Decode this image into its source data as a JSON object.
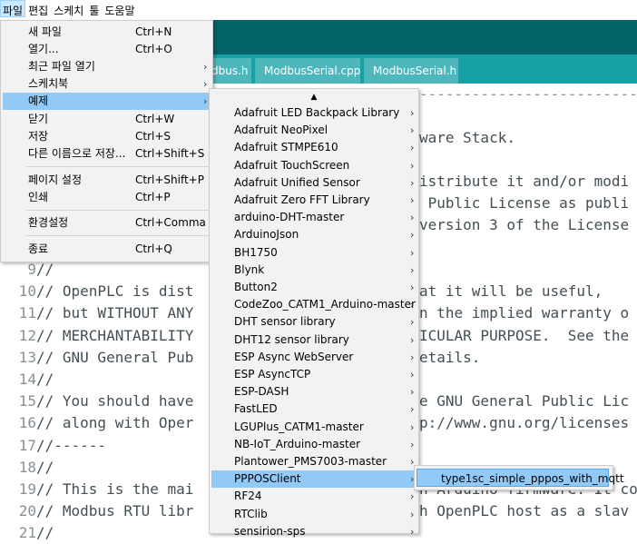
{
  "menubar": [
    "파일",
    "편집",
    "스케치",
    "툴",
    "도움말"
  ],
  "tabs": [
    "dbus.h",
    "ModbusSerial.cpp",
    "ModbusSerial.h"
  ],
  "file_menu": [
    {
      "label": "새 파일",
      "shortcut": "Ctrl+N",
      "arrow": ""
    },
    {
      "label": "열기...",
      "shortcut": "Ctrl+O",
      "arrow": ""
    },
    {
      "label": "최근 파일 열기",
      "shortcut": "",
      "arrow": "›"
    },
    {
      "label": "스케치북",
      "shortcut": "",
      "arrow": "›"
    },
    {
      "label": "예제",
      "shortcut": "",
      "arrow": "›"
    },
    {
      "label": "닫기",
      "shortcut": "Ctrl+W",
      "arrow": ""
    },
    {
      "label": "저장",
      "shortcut": "Ctrl+S",
      "arrow": ""
    },
    {
      "label": "다른 이름으로 저장...",
      "shortcut": "Ctrl+Shift+S",
      "arrow": ""
    },
    {
      "label": "페이지 설정",
      "shortcut": "Ctrl+Shift+P",
      "arrow": ""
    },
    {
      "label": "인쇄",
      "shortcut": "Ctrl+P",
      "arrow": ""
    },
    {
      "label": "환경설정",
      "shortcut": "Ctrl+Comma",
      "arrow": ""
    },
    {
      "label": "종료",
      "shortcut": "Ctrl+Q",
      "arrow": ""
    }
  ],
  "examples_menu": {
    "scroll_up": "▲",
    "items": [
      "Adafruit LED Backpack Library",
      "Adafruit NeoPixel",
      "Adafruit STMPE610",
      "Adafruit TouchScreen",
      "Adafruit Unified Sensor",
      "Adafruit Zero FFT Library",
      "arduino-DHT-master",
      "ArduinoJson",
      "BH1750",
      "Blynk",
      "Button2",
      "CodeZoo_CATM1_Arduino-master",
      "DHT sensor library",
      "DHT12 sensor library",
      "ESP Async WebServer",
      "ESP AsyncTCP",
      "ESP-DASH",
      "FastLED",
      "LGUPlus_CATM1-master",
      "NB-IoT_Arduino-master",
      "Plantower_PMS7003-master",
      "PPPOSClient",
      "RF24",
      "RTClib",
      "sensirion-sps"
    ],
    "arrow": "›"
  },
  "submenu": {
    "item": "type1sc_simple_pppos_with_mqtt"
  },
  "code_partial": [
    "ware Stack.",
    "istribute it and/or modi",
    " Public License as publi",
    "version 3 of the License"
  ],
  "code_lines": [
    {
      "num": "9",
      "text": "//",
      "right": ""
    },
    {
      "num": "10",
      "text": "// OpenPLC is dist",
      "right": "at it will be useful,"
    },
    {
      "num": "11",
      "text": "// but WITHOUT ANY",
      "right": "n the implied warranty o"
    },
    {
      "num": "12",
      "text": "// MERCHANTABILITY",
      "right": "ICULAR PURPOSE.  See the"
    },
    {
      "num": "13",
      "text": "// GNU General Pub",
      "right": "etails."
    },
    {
      "num": "14",
      "text": "//",
      "right": ""
    },
    {
      "num": "15",
      "text": "// You should have",
      "right": "e GNU General Public Lic"
    },
    {
      "num": "16",
      "text": "// along with Oper",
      "right": "p://www.gnu.org/licenses"
    },
    {
      "num": "17",
      "text": "//------",
      "right": ""
    },
    {
      "num": "18",
      "text": "//",
      "right": ""
    },
    {
      "num": "19",
      "text": "// This is the mai",
      "right": "h Arduino firmware. It co"
    },
    {
      "num": "20",
      "text": "// Modbus RTU libr",
      "right": "h OpenPLC host as a slav"
    },
    {
      "num": "21",
      "text": "//",
      "right": ""
    }
  ],
  "dashes": "--------------------------"
}
